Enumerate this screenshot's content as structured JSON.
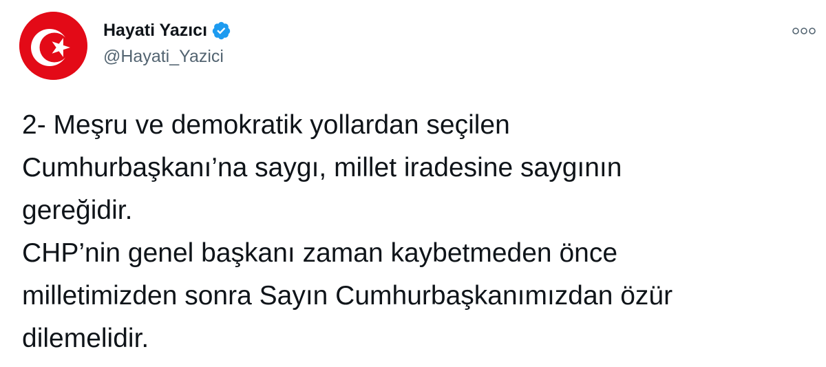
{
  "author": {
    "display_name": "Hayati Yazıcı",
    "handle": "@Hayati_Yazici",
    "avatar_icon": "turkish-flag-avatar",
    "verified_icon": "verified-badge-icon"
  },
  "menu": {
    "icon": "more-options-icon"
  },
  "tweet": {
    "lines": [
      "2- Meşru ve demokratik yollardan seçilen",
      "Cumhurbaşkanı’na saygı, millet iradesine saygının",
      "gereğidir.",
      "CHP’nin genel başkanı zaman kaybetmeden önce",
      "milletimizden sonra Sayın Cumhurbaşkanımızdan özür",
      "dilemelidir."
    ]
  },
  "colors": {
    "flag_red": "#e30a17",
    "verified_blue": "#1d9bf0",
    "text": "#0f1419",
    "secondary_text": "#536471"
  }
}
